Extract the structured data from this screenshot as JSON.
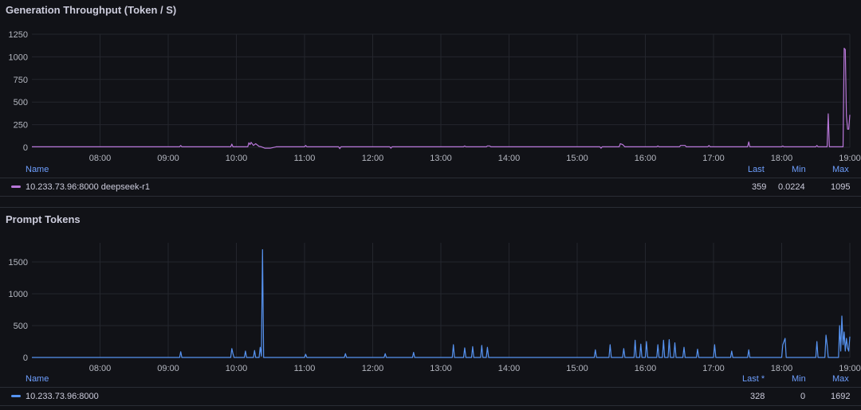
{
  "panels": [
    {
      "title": "Generation Throughput (Token / S)",
      "color": "#b877d9",
      "legend": {
        "name_header": "Name",
        "last_header": "Last",
        "min_header": "Min",
        "max_header": "Max",
        "series_name": "10.233.73.96:8000 deepseek-r1",
        "last": "359",
        "min": "0.0224",
        "max": "1095"
      }
    },
    {
      "title": "Prompt Tokens",
      "color": "#5794f2",
      "legend": {
        "name_header": "Name",
        "last_header": "Last *",
        "min_header": "Min",
        "max_header": "Max",
        "series_name": "10.233.73.96:8000",
        "last": "328",
        "min": "0",
        "max": "1692"
      }
    }
  ],
  "chart_data": [
    {
      "type": "line",
      "title": "Generation Throughput (Token / S)",
      "x_ticks": [
        "08:00",
        "09:00",
        "10:00",
        "11:00",
        "12:00",
        "13:00",
        "14:00",
        "15:00",
        "16:00",
        "17:00",
        "18:00",
        "19:00"
      ],
      "y_ticks": [
        0,
        250,
        500,
        750,
        1000,
        1250
      ],
      "ylim": [
        0,
        1250
      ],
      "xlim": [
        "07:00",
        "19:00"
      ],
      "series": [
        {
          "name": "10.233.73.96:8000 deepseek-r1",
          "color": "#b877d9",
          "points": [
            [
              "07:00",
              5
            ],
            [
              "09:10",
              5
            ],
            [
              "09:11",
              20
            ],
            [
              "09:12",
              5
            ],
            [
              "09:55",
              5
            ],
            [
              "09:56",
              35
            ],
            [
              "09:57",
              5
            ],
            [
              "10:10",
              5
            ],
            [
              "10:11",
              50
            ],
            [
              "10:12",
              30
            ],
            [
              "10:13",
              55
            ],
            [
              "10:15",
              20
            ],
            [
              "10:17",
              40
            ],
            [
              "10:20",
              10
            ],
            [
              "10:22",
              5
            ],
            [
              "10:25",
              -10
            ],
            [
              "10:30",
              -10
            ],
            [
              "10:35",
              5
            ],
            [
              "11:00",
              5
            ],
            [
              "11:01",
              20
            ],
            [
              "11:02",
              5
            ],
            [
              "11:30",
              5
            ],
            [
              "11:31",
              -15
            ],
            [
              "11:32",
              5
            ],
            [
              "12:15",
              5
            ],
            [
              "12:16",
              -10
            ],
            [
              "12:17",
              5
            ],
            [
              "13:20",
              5
            ],
            [
              "13:21",
              15
            ],
            [
              "13:22",
              5
            ],
            [
              "13:40",
              5
            ],
            [
              "13:41",
              15
            ],
            [
              "13:43",
              15
            ],
            [
              "13:44",
              5
            ],
            [
              "15:20",
              5
            ],
            [
              "15:21",
              -10
            ],
            [
              "15:22",
              5
            ],
            [
              "15:37",
              5
            ],
            [
              "15:38",
              40
            ],
            [
              "15:40",
              30
            ],
            [
              "15:42",
              5
            ],
            [
              "16:10",
              5
            ],
            [
              "16:11",
              15
            ],
            [
              "16:12",
              5
            ],
            [
              "16:30",
              5
            ],
            [
              "16:31",
              20
            ],
            [
              "16:35",
              20
            ],
            [
              "16:36",
              5
            ],
            [
              "16:55",
              5
            ],
            [
              "16:56",
              20
            ],
            [
              "16:57",
              5
            ],
            [
              "17:30",
              5
            ],
            [
              "17:31",
              60
            ],
            [
              "17:32",
              5
            ],
            [
              "18:00",
              5
            ],
            [
              "18:01",
              15
            ],
            [
              "18:02",
              5
            ],
            [
              "18:30",
              5
            ],
            [
              "18:31",
              20
            ],
            [
              "18:32",
              5
            ],
            [
              "18:40",
              5
            ],
            [
              "18:41",
              370
            ],
            [
              "18:42",
              5
            ],
            [
              "18:54",
              5
            ],
            [
              "18:55",
              1095
            ],
            [
              "18:56",
              1080
            ],
            [
              "18:57",
              350
            ],
            [
              "18:58",
              200
            ],
            [
              "18:59",
              200
            ],
            [
              "19:00",
              359
            ]
          ]
        }
      ]
    },
    {
      "type": "line",
      "title": "Prompt Tokens",
      "x_ticks": [
        "08:00",
        "09:00",
        "10:00",
        "11:00",
        "12:00",
        "13:00",
        "14:00",
        "15:00",
        "16:00",
        "17:00",
        "18:00",
        "19:00"
      ],
      "y_ticks": [
        0,
        500,
        1000,
        1500
      ],
      "ylim": [
        0,
        1800
      ],
      "xlim": [
        "07:00",
        "19:00"
      ],
      "series": [
        {
          "name": "10.233.73.96:8000",
          "color": "#5794f2",
          "points": [
            [
              "07:00",
              0
            ],
            [
              "09:10",
              0
            ],
            [
              "09:11",
              90
            ],
            [
              "09:12",
              0
            ],
            [
              "09:55",
              0
            ],
            [
              "09:56",
              140
            ],
            [
              "09:57",
              60
            ],
            [
              "09:58",
              0
            ],
            [
              "10:07",
              0
            ],
            [
              "10:08",
              100
            ],
            [
              "10:09",
              0
            ],
            [
              "10:15",
              0
            ],
            [
              "10:16",
              110
            ],
            [
              "10:17",
              0
            ],
            [
              "10:20",
              0
            ],
            [
              "10:21",
              160
            ],
            [
              "10:22",
              20
            ],
            [
              "10:23",
              1692
            ],
            [
              "10:24",
              0
            ],
            [
              "11:00",
              0
            ],
            [
              "11:01",
              50
            ],
            [
              "11:02",
              0
            ],
            [
              "11:35",
              0
            ],
            [
              "11:36",
              60
            ],
            [
              "11:37",
              0
            ],
            [
              "12:10",
              0
            ],
            [
              "12:11",
              60
            ],
            [
              "12:12",
              0
            ],
            [
              "12:35",
              0
            ],
            [
              "12:36",
              80
            ],
            [
              "12:37",
              0
            ],
            [
              "13:10",
              0
            ],
            [
              "13:11",
              200
            ],
            [
              "13:12",
              0
            ],
            [
              "13:20",
              0
            ],
            [
              "13:21",
              150
            ],
            [
              "13:22",
              0
            ],
            [
              "13:27",
              0
            ],
            [
              "13:28",
              170
            ],
            [
              "13:29",
              0
            ],
            [
              "13:35",
              0
            ],
            [
              "13:36",
              190
            ],
            [
              "13:37",
              0
            ],
            [
              "13:40",
              0
            ],
            [
              "13:41",
              160
            ],
            [
              "13:42",
              0
            ],
            [
              "15:15",
              0
            ],
            [
              "15:16",
              120
            ],
            [
              "15:17",
              0
            ],
            [
              "15:28",
              0
            ],
            [
              "15:29",
              200
            ],
            [
              "15:30",
              0
            ],
            [
              "15:40",
              0
            ],
            [
              "15:41",
              140
            ],
            [
              "15:42",
              0
            ],
            [
              "15:50",
              0
            ],
            [
              "15:51",
              270
            ],
            [
              "15:52",
              0
            ],
            [
              "15:55",
              0
            ],
            [
              "15:56",
              210
            ],
            [
              "15:57",
              0
            ],
            [
              "16:00",
              0
            ],
            [
              "16:01",
              250
            ],
            [
              "16:02",
              0
            ],
            [
              "16:10",
              0
            ],
            [
              "16:11",
              200
            ],
            [
              "16:12",
              0
            ],
            [
              "16:15",
              0
            ],
            [
              "16:16",
              270
            ],
            [
              "16:17",
              0
            ],
            [
              "16:20",
              0
            ],
            [
              "16:21",
              280
            ],
            [
              "16:22",
              0
            ],
            [
              "16:25",
              0
            ],
            [
              "16:26",
              230
            ],
            [
              "16:27",
              0
            ],
            [
              "16:33",
              0
            ],
            [
              "16:34",
              160
            ],
            [
              "16:35",
              0
            ],
            [
              "16:45",
              0
            ],
            [
              "16:46",
              130
            ],
            [
              "16:47",
              0
            ],
            [
              "17:00",
              0
            ],
            [
              "17:01",
              200
            ],
            [
              "17:02",
              0
            ],
            [
              "17:15",
              0
            ],
            [
              "17:16",
              100
            ],
            [
              "17:17",
              0
            ],
            [
              "17:30",
              0
            ],
            [
              "17:31",
              120
            ],
            [
              "17:32",
              0
            ],
            [
              "18:00",
              0
            ],
            [
              "18:01",
              200
            ],
            [
              "18:03",
              300
            ],
            [
              "18:04",
              0
            ],
            [
              "18:30",
              0
            ],
            [
              "18:31",
              250
            ],
            [
              "18:32",
              0
            ],
            [
              "18:38",
              0
            ],
            [
              "18:39",
              350
            ],
            [
              "18:40",
              200
            ],
            [
              "18:41",
              0
            ],
            [
              "18:50",
              0
            ],
            [
              "18:51",
              500
            ],
            [
              "18:52",
              100
            ],
            [
              "18:53",
              650
            ],
            [
              "18:54",
              200
            ],
            [
              "18:55",
              400
            ],
            [
              "18:56",
              100
            ],
            [
              "18:57",
              300
            ],
            [
              "18:58",
              150
            ],
            [
              "18:59",
              100
            ],
            [
              "19:00",
              328
            ]
          ]
        }
      ]
    }
  ]
}
